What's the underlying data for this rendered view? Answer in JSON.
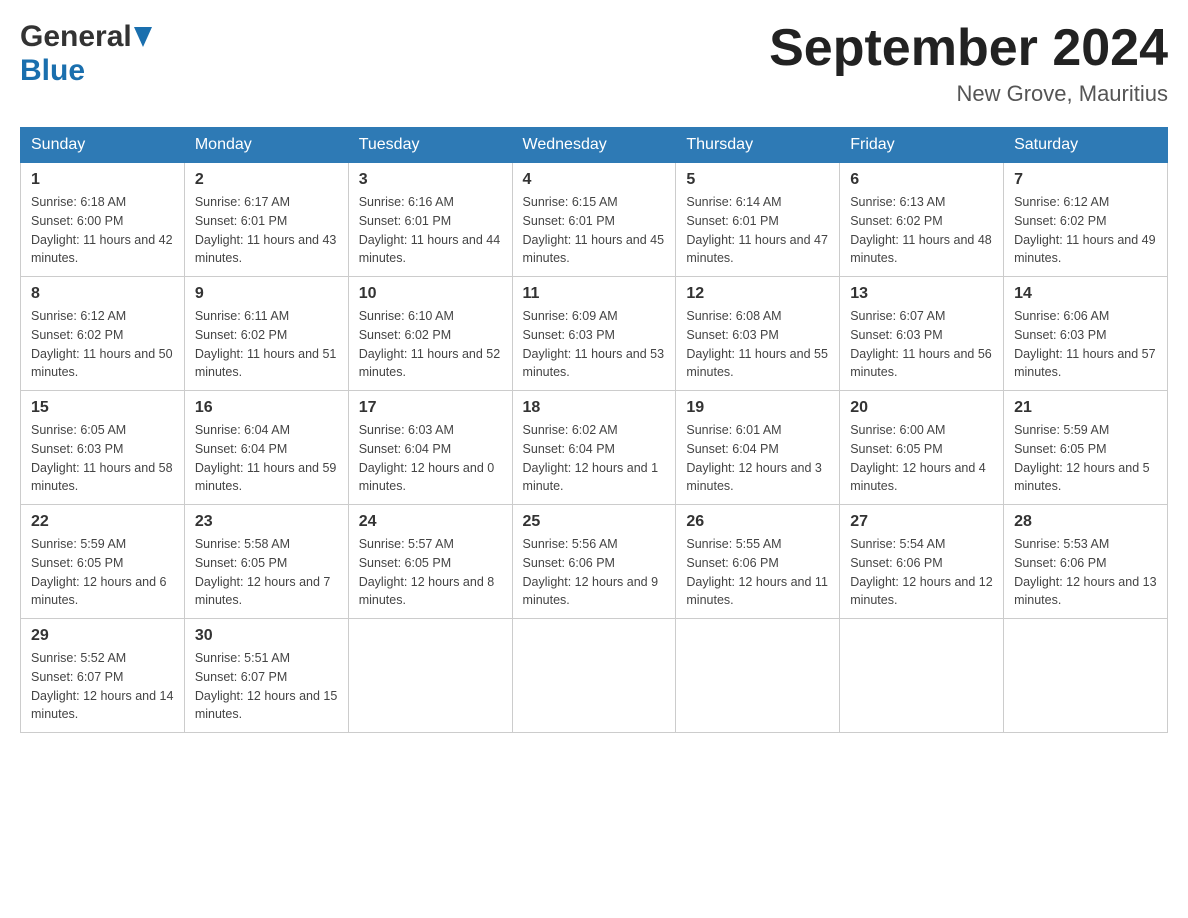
{
  "logo": {
    "general": "General",
    "blue": "Blue"
  },
  "title": "September 2024",
  "location": "New Grove, Mauritius",
  "weekdays": [
    "Sunday",
    "Monday",
    "Tuesday",
    "Wednesday",
    "Thursday",
    "Friday",
    "Saturday"
  ],
  "weeks": [
    [
      {
        "day": "1",
        "sunrise": "Sunrise: 6:18 AM",
        "sunset": "Sunset: 6:00 PM",
        "daylight": "Daylight: 11 hours and 42 minutes."
      },
      {
        "day": "2",
        "sunrise": "Sunrise: 6:17 AM",
        "sunset": "Sunset: 6:01 PM",
        "daylight": "Daylight: 11 hours and 43 minutes."
      },
      {
        "day": "3",
        "sunrise": "Sunrise: 6:16 AM",
        "sunset": "Sunset: 6:01 PM",
        "daylight": "Daylight: 11 hours and 44 minutes."
      },
      {
        "day": "4",
        "sunrise": "Sunrise: 6:15 AM",
        "sunset": "Sunset: 6:01 PM",
        "daylight": "Daylight: 11 hours and 45 minutes."
      },
      {
        "day": "5",
        "sunrise": "Sunrise: 6:14 AM",
        "sunset": "Sunset: 6:01 PM",
        "daylight": "Daylight: 11 hours and 47 minutes."
      },
      {
        "day": "6",
        "sunrise": "Sunrise: 6:13 AM",
        "sunset": "Sunset: 6:02 PM",
        "daylight": "Daylight: 11 hours and 48 minutes."
      },
      {
        "day": "7",
        "sunrise": "Sunrise: 6:12 AM",
        "sunset": "Sunset: 6:02 PM",
        "daylight": "Daylight: 11 hours and 49 minutes."
      }
    ],
    [
      {
        "day": "8",
        "sunrise": "Sunrise: 6:12 AM",
        "sunset": "Sunset: 6:02 PM",
        "daylight": "Daylight: 11 hours and 50 minutes."
      },
      {
        "day": "9",
        "sunrise": "Sunrise: 6:11 AM",
        "sunset": "Sunset: 6:02 PM",
        "daylight": "Daylight: 11 hours and 51 minutes."
      },
      {
        "day": "10",
        "sunrise": "Sunrise: 6:10 AM",
        "sunset": "Sunset: 6:02 PM",
        "daylight": "Daylight: 11 hours and 52 minutes."
      },
      {
        "day": "11",
        "sunrise": "Sunrise: 6:09 AM",
        "sunset": "Sunset: 6:03 PM",
        "daylight": "Daylight: 11 hours and 53 minutes."
      },
      {
        "day": "12",
        "sunrise": "Sunrise: 6:08 AM",
        "sunset": "Sunset: 6:03 PM",
        "daylight": "Daylight: 11 hours and 55 minutes."
      },
      {
        "day": "13",
        "sunrise": "Sunrise: 6:07 AM",
        "sunset": "Sunset: 6:03 PM",
        "daylight": "Daylight: 11 hours and 56 minutes."
      },
      {
        "day": "14",
        "sunrise": "Sunrise: 6:06 AM",
        "sunset": "Sunset: 6:03 PM",
        "daylight": "Daylight: 11 hours and 57 minutes."
      }
    ],
    [
      {
        "day": "15",
        "sunrise": "Sunrise: 6:05 AM",
        "sunset": "Sunset: 6:03 PM",
        "daylight": "Daylight: 11 hours and 58 minutes."
      },
      {
        "day": "16",
        "sunrise": "Sunrise: 6:04 AM",
        "sunset": "Sunset: 6:04 PM",
        "daylight": "Daylight: 11 hours and 59 minutes."
      },
      {
        "day": "17",
        "sunrise": "Sunrise: 6:03 AM",
        "sunset": "Sunset: 6:04 PM",
        "daylight": "Daylight: 12 hours and 0 minutes."
      },
      {
        "day": "18",
        "sunrise": "Sunrise: 6:02 AM",
        "sunset": "Sunset: 6:04 PM",
        "daylight": "Daylight: 12 hours and 1 minute."
      },
      {
        "day": "19",
        "sunrise": "Sunrise: 6:01 AM",
        "sunset": "Sunset: 6:04 PM",
        "daylight": "Daylight: 12 hours and 3 minutes."
      },
      {
        "day": "20",
        "sunrise": "Sunrise: 6:00 AM",
        "sunset": "Sunset: 6:05 PM",
        "daylight": "Daylight: 12 hours and 4 minutes."
      },
      {
        "day": "21",
        "sunrise": "Sunrise: 5:59 AM",
        "sunset": "Sunset: 6:05 PM",
        "daylight": "Daylight: 12 hours and 5 minutes."
      }
    ],
    [
      {
        "day": "22",
        "sunrise": "Sunrise: 5:59 AM",
        "sunset": "Sunset: 6:05 PM",
        "daylight": "Daylight: 12 hours and 6 minutes."
      },
      {
        "day": "23",
        "sunrise": "Sunrise: 5:58 AM",
        "sunset": "Sunset: 6:05 PM",
        "daylight": "Daylight: 12 hours and 7 minutes."
      },
      {
        "day": "24",
        "sunrise": "Sunrise: 5:57 AM",
        "sunset": "Sunset: 6:05 PM",
        "daylight": "Daylight: 12 hours and 8 minutes."
      },
      {
        "day": "25",
        "sunrise": "Sunrise: 5:56 AM",
        "sunset": "Sunset: 6:06 PM",
        "daylight": "Daylight: 12 hours and 9 minutes."
      },
      {
        "day": "26",
        "sunrise": "Sunrise: 5:55 AM",
        "sunset": "Sunset: 6:06 PM",
        "daylight": "Daylight: 12 hours and 11 minutes."
      },
      {
        "day": "27",
        "sunrise": "Sunrise: 5:54 AM",
        "sunset": "Sunset: 6:06 PM",
        "daylight": "Daylight: 12 hours and 12 minutes."
      },
      {
        "day": "28",
        "sunrise": "Sunrise: 5:53 AM",
        "sunset": "Sunset: 6:06 PM",
        "daylight": "Daylight: 12 hours and 13 minutes."
      }
    ],
    [
      {
        "day": "29",
        "sunrise": "Sunrise: 5:52 AM",
        "sunset": "Sunset: 6:07 PM",
        "daylight": "Daylight: 12 hours and 14 minutes."
      },
      {
        "day": "30",
        "sunrise": "Sunrise: 5:51 AM",
        "sunset": "Sunset: 6:07 PM",
        "daylight": "Daylight: 12 hours and 15 minutes."
      },
      null,
      null,
      null,
      null,
      null
    ]
  ]
}
